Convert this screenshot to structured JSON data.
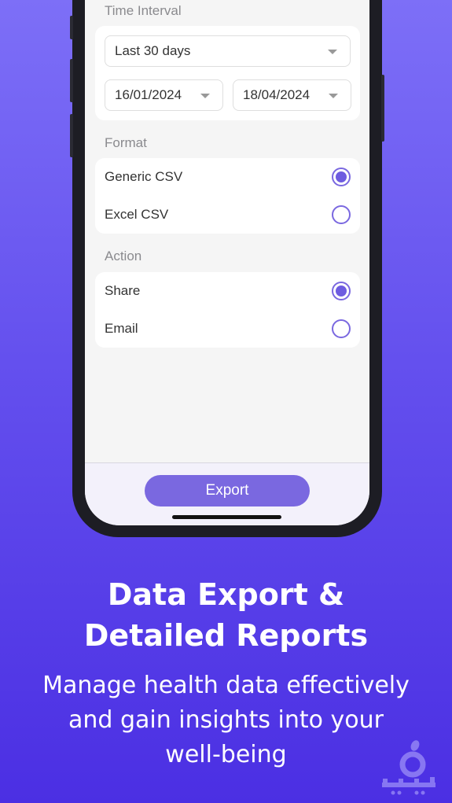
{
  "form": {
    "time_interval_label": "Time Interval",
    "range_select": "Last 30 days",
    "start_date": "16/01/2024",
    "end_date": "18/04/2024",
    "format_label": "Format",
    "formats": [
      {
        "label": "Generic CSV",
        "selected": true
      },
      {
        "label": "Excel CSV",
        "selected": false
      }
    ],
    "action_label": "Action",
    "actions": [
      {
        "label": "Share",
        "selected": true
      },
      {
        "label": "Email",
        "selected": false
      }
    ],
    "export_button": "Export"
  },
  "promo": {
    "title": "Data Export & Detailed Reports",
    "subtitle": "Manage health data effectively and gain insights into your well-being"
  },
  "watermark": "سیبچه",
  "colors": {
    "accent": "#7a68e0",
    "bg_top": "#7d6ff7",
    "bg_bottom": "#4b2fe3"
  }
}
